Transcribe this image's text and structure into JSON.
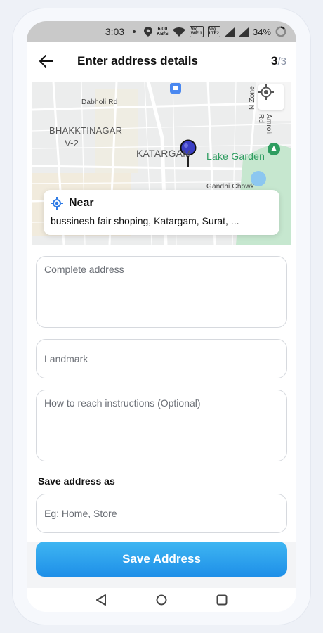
{
  "status_bar": {
    "time": "3:03",
    "speed_top": "6.00",
    "speed_bottom": "KB/S",
    "volte1_top": "Vo)",
    "volte1_bottom": "WiFi1",
    "volte2_top": "Vo)",
    "volte2_bottom": "LTE2",
    "battery": "34%"
  },
  "header": {
    "title": "Enter address details",
    "step_current": "3",
    "step_total": "/3"
  },
  "map": {
    "labels": {
      "dabholi_rd": "Dabholi Rd",
      "bhakti_1": "BHAKKTINAGAR",
      "bhakti_2": "V-2",
      "katargam": "KATARGAM",
      "lake_garden": "Lake Garden",
      "gandhi_chowk": "Gandhi Chowk",
      "n_zone": "N Zone",
      "amroli_rd": "Amroli Rd"
    }
  },
  "near_card": {
    "title": "Near",
    "address": "bussinesh fair shoping, Katargam, Surat, ..."
  },
  "form": {
    "complete_address_placeholder": "Complete address",
    "landmark_placeholder": "Landmark",
    "instructions_placeholder": "How to reach instructions (Optional)",
    "save_as_label": "Save address as",
    "save_as_placeholder": "Eg: Home, Store",
    "save_button": "Save Address"
  },
  "colors": {
    "accent": "#1e8fe8",
    "pin": "#3b3fc4",
    "green": "#2e9d60"
  }
}
